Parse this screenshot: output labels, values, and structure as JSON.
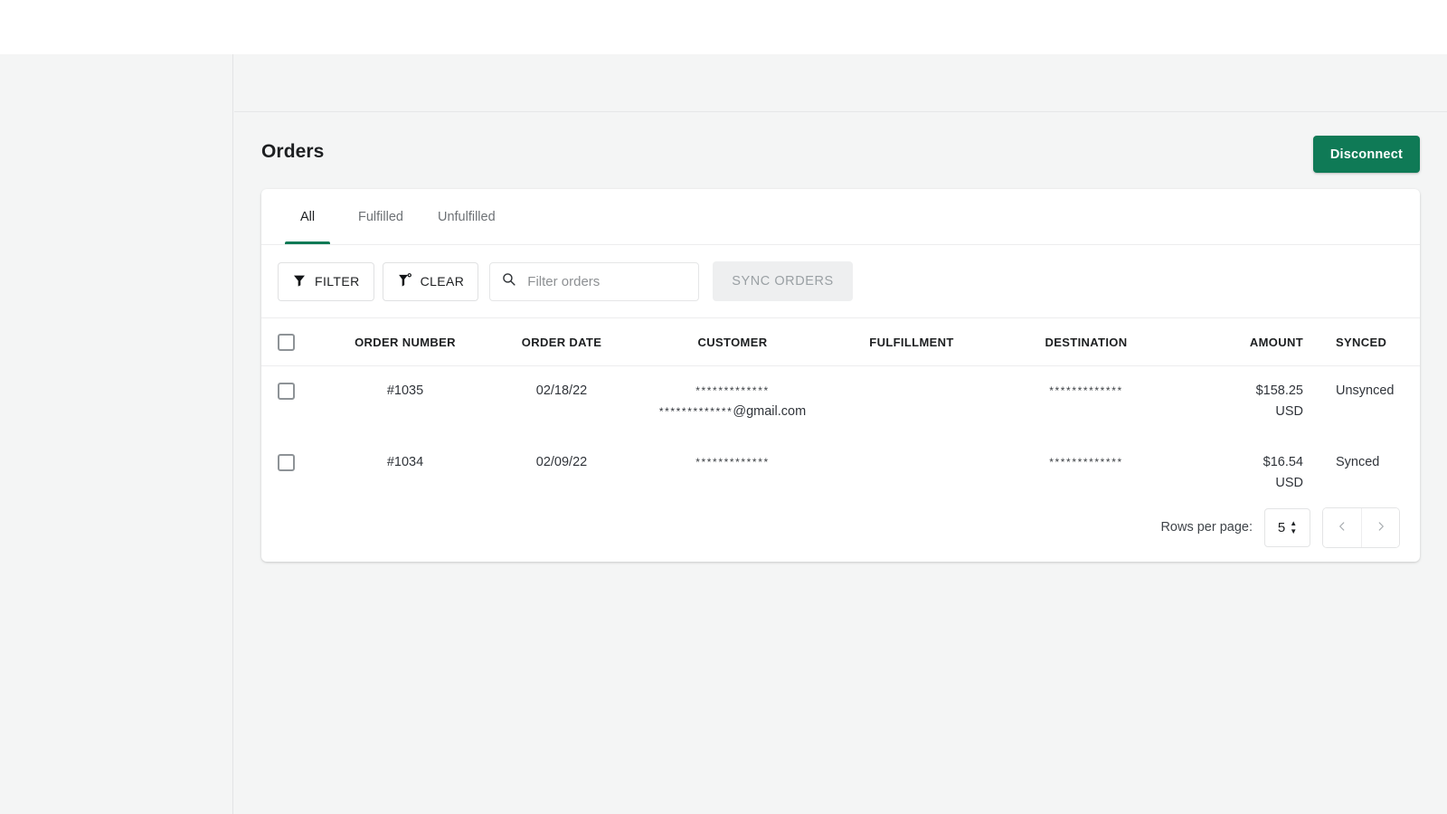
{
  "header": {
    "title": "Orders",
    "disconnect_label": "Disconnect"
  },
  "tabs": [
    {
      "label": "All",
      "active": true
    },
    {
      "label": "Fulfilled",
      "active": false
    },
    {
      "label": "Unfulfilled",
      "active": false
    }
  ],
  "toolbar": {
    "filter_label": "FILTER",
    "clear_label": "CLEAR",
    "search_placeholder": "Filter orders",
    "search_value": "",
    "sync_label": "SYNC ORDERS",
    "sync_disabled": true
  },
  "table": {
    "columns": [
      "ORDER NUMBER",
      "ORDER DATE",
      "CUSTOMER",
      "FULFILLMENT",
      "DESTINATION",
      "AMOUNT",
      "SYNCED"
    ],
    "rows": [
      {
        "order_number": "#1035",
        "order_date": "02/18/22",
        "customer_name": "*************",
        "customer_email_mask": "*************",
        "customer_email_domain": "@gmail.com",
        "fulfillment": "",
        "destination": "*************",
        "amount_value": "$158.25",
        "amount_currency": "USD",
        "synced": "Unsynced"
      },
      {
        "order_number": "#1034",
        "order_date": "02/09/22",
        "customer_name": "*************",
        "customer_email_mask": "",
        "customer_email_domain": "",
        "fulfillment": "",
        "destination": "*************",
        "amount_value": "$16.54",
        "amount_currency": "USD",
        "synced": "Synced"
      }
    ]
  },
  "pagination": {
    "rows_per_page_label": "Rows per page:",
    "rows_per_page_value": "5",
    "prev_label": "‹",
    "next_label": "›"
  },
  "colors": {
    "brand_green": "#0f7a56",
    "page_bg": "#f4f5f5",
    "card_bg": "#ffffff",
    "text_primary": "#1d1f21",
    "text_muted": "#6d7175"
  }
}
